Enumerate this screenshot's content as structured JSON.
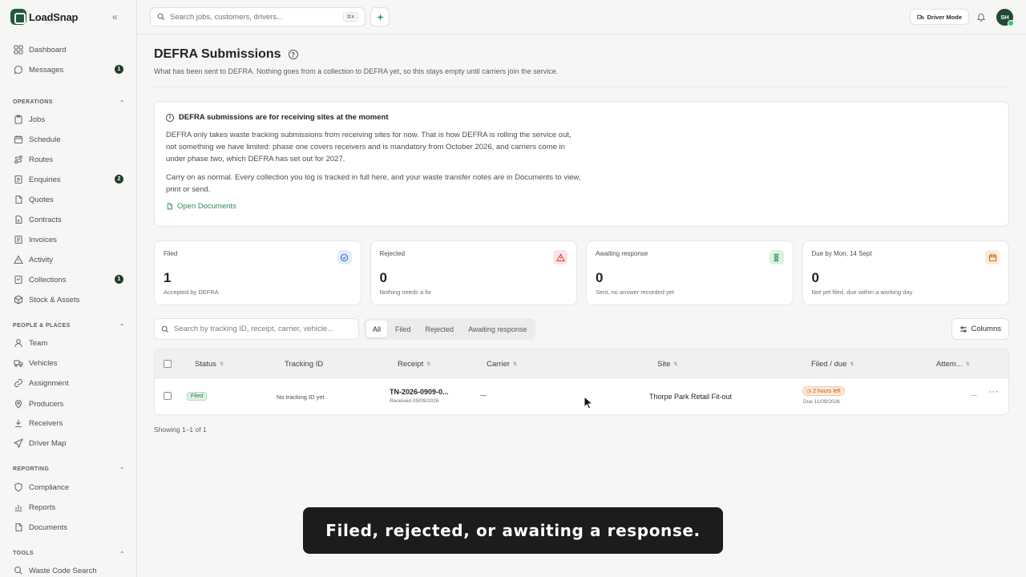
{
  "brand": {
    "name": "LoadSnap",
    "color": "#1f5a3e"
  },
  "sidebar": {
    "items_top": [
      {
        "label": "Dashboard",
        "icon": "grid-icon"
      },
      {
        "label": "Messages",
        "icon": "message-icon",
        "badge": "1"
      }
    ],
    "sections": [
      {
        "title": "OPERATIONS",
        "items": [
          {
            "label": "Jobs",
            "icon": "clipboard-icon"
          },
          {
            "label": "Schedule",
            "icon": "calendar-icon"
          },
          {
            "label": "Routes",
            "icon": "route-icon"
          },
          {
            "label": "Enquiries",
            "icon": "file-icon",
            "badge": "2"
          },
          {
            "label": "Quotes",
            "icon": "quote-icon"
          },
          {
            "label": "Contracts",
            "icon": "contract-icon"
          },
          {
            "label": "Invoices",
            "icon": "invoice-icon"
          },
          {
            "label": "Activity",
            "icon": "warning-icon"
          },
          {
            "label": "Collections",
            "icon": "collection-icon",
            "badge": "1"
          },
          {
            "label": "Stock & Assets",
            "icon": "box-icon"
          }
        ]
      },
      {
        "title": "PEOPLE & PLACES",
        "items": [
          {
            "label": "Team",
            "icon": "user-icon"
          },
          {
            "label": "Vehicles",
            "icon": "truck-icon"
          },
          {
            "label": "Assignment",
            "icon": "link-icon"
          },
          {
            "label": "Producers",
            "icon": "pin-icon"
          },
          {
            "label": "Receivers",
            "icon": "download-icon"
          },
          {
            "label": "Driver Map",
            "icon": "send-icon"
          }
        ]
      },
      {
        "title": "REPORTING",
        "items": [
          {
            "label": "Compliance",
            "icon": "shield-icon"
          },
          {
            "label": "Reports",
            "icon": "bar-chart-icon"
          },
          {
            "label": "Documents",
            "icon": "document-icon"
          }
        ]
      },
      {
        "title": "TOOLS",
        "items": [
          {
            "label": "Waste Code Search",
            "icon": "search-icon"
          }
        ]
      }
    ]
  },
  "topbar": {
    "search_placeholder": "Search jobs, customers, drivers...",
    "shortcut": "⌘K",
    "driver_mode": "Driver Mode",
    "avatar": "SH"
  },
  "page": {
    "title": "DEFRA Submissions",
    "subtitle": "What has been sent to DEFRA. Nothing goes from a collection to DEFRA yet, so this stays empty until carriers join the service."
  },
  "notice": {
    "title": "DEFRA submissions are for receiving sites at the moment",
    "p1": "DEFRA only takes waste tracking submissions from receiving sites for now. That is how DEFRA is rolling the service out, not something we have limited: phase one covers receivers and is mandatory from October 2026, and carriers come in under phase two, which DEFRA has set out for 2027.",
    "p2": "Carry on as normal. Every collection you log is tracked in full here, and your waste transfer notes are in Documents to view, print or send.",
    "link": "Open Documents"
  },
  "stats": [
    {
      "label": "Filed",
      "value": "1",
      "desc": "Accepted by DEFRA",
      "icon": "check-circle-icon",
      "color": "#3b6fd6",
      "bg": "#e3ebfb"
    },
    {
      "label": "Rejected",
      "value": "0",
      "desc": "Nothing needs a fix",
      "icon": "alert-triangle-icon",
      "color": "#d64545",
      "bg": "#fbe3e3"
    },
    {
      "label": "Awaiting response",
      "value": "0",
      "desc": "Sent, no answer recorded yet",
      "icon": "hourglass-icon",
      "color": "#2e8a55",
      "bg": "#dcf1e2"
    },
    {
      "label": "Due by Mon, 14 Sept",
      "value": "0",
      "desc": "Not yet filed, due within a working day",
      "icon": "calendar-icon",
      "color": "#c2741e",
      "bg": "#fdebd8"
    }
  ],
  "filters": {
    "search_placeholder": "Search by tracking ID, receipt, carrier, vehicle...",
    "tabs": [
      "All",
      "Filed",
      "Rejected",
      "Awaiting response"
    ],
    "active_tab": "All",
    "columns_label": "Columns"
  },
  "table": {
    "headers": [
      "Status",
      "Tracking ID",
      "Receipt",
      "Carrier",
      "Site",
      "Filed / due",
      "Attem..."
    ],
    "rows": [
      {
        "status": "Filed",
        "tracking": "No tracking ID yet",
        "receipt": "TN-2026-0909-0...",
        "receipt_sub": "Received 09/09/2026",
        "carrier": "—",
        "site": "Thorpe Park Retail Fit-out",
        "due_pill": "2 hours left",
        "due_sub": "Due 11/09/2026",
        "attempts": "—"
      }
    ]
  },
  "footer": {
    "showing": "Showing 1–1 of 1"
  },
  "caption": "Filed, rejected, or awaiting a response."
}
